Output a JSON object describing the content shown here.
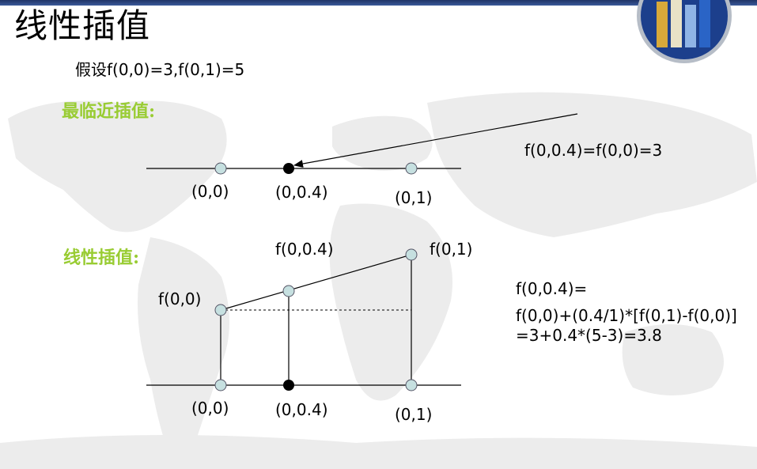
{
  "title": "线性插值",
  "assumption": "假设f(0,0)=3,f(0,1)=5",
  "sections": {
    "nearest": {
      "heading": "最临近插值:",
      "labels": {
        "p0": "(0,0)",
        "pmid": "(0,0.4)",
        "p1": "(0,1)"
      },
      "result": "f(0,0.4)=f(0,0)=3"
    },
    "linear": {
      "heading": "线性插值:",
      "point_labels": {
        "f0": "f(0,0)",
        "fmid": "f(0,0.4)",
        "f1": "f(0,1)"
      },
      "axis_labels": {
        "p0": "(0,0)",
        "pmid": "(0,0.4)",
        "p1": "(0,1)"
      },
      "formula": [
        "f(0,0.4)=",
        "f(0,0)+(0.4/1)*[f(0,1)-f(0,0)]",
        "=3+0.4*(5-3)=3.8"
      ]
    }
  },
  "colors": {
    "heading_green": "#99cc33",
    "open_point_fill": "#c6e0e0",
    "filled_point": "#000000",
    "map_gray": "#ececec",
    "top_bar": "#2a4580"
  }
}
